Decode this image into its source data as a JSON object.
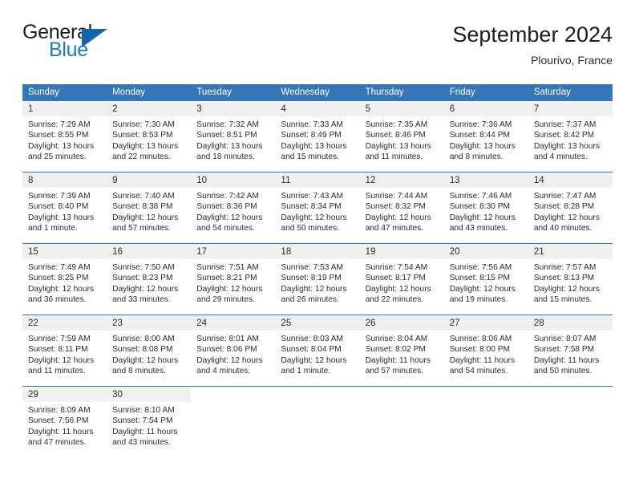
{
  "brand": {
    "line1": "General",
    "line2": "Blue",
    "triangle_color": "#1565a8",
    "blue_text_color": "#1f7ac4"
  },
  "header": {
    "title": "September 2024",
    "subtitle": "Plourivo, France"
  },
  "theme": {
    "header_bg": "#3576b8",
    "daynum_bg": "#f0f0f0",
    "text": "#2b2b2b",
    "row_divider": "#3576b8"
  },
  "weekdays": [
    "Sunday",
    "Monday",
    "Tuesday",
    "Wednesday",
    "Thursday",
    "Friday",
    "Saturday"
  ],
  "weeks": [
    [
      {
        "day": "1",
        "sunrise": "Sunrise: 7:29 AM",
        "sunset": "Sunset: 8:55 PM",
        "daylight": "Daylight: 13 hours and 25 minutes."
      },
      {
        "day": "2",
        "sunrise": "Sunrise: 7:30 AM",
        "sunset": "Sunset: 8:53 PM",
        "daylight": "Daylight: 13 hours and 22 minutes."
      },
      {
        "day": "3",
        "sunrise": "Sunrise: 7:32 AM",
        "sunset": "Sunset: 8:51 PM",
        "daylight": "Daylight: 13 hours and 18 minutes."
      },
      {
        "day": "4",
        "sunrise": "Sunrise: 7:33 AM",
        "sunset": "Sunset: 8:49 PM",
        "daylight": "Daylight: 13 hours and 15 minutes."
      },
      {
        "day": "5",
        "sunrise": "Sunrise: 7:35 AM",
        "sunset": "Sunset: 8:46 PM",
        "daylight": "Daylight: 13 hours and 11 minutes."
      },
      {
        "day": "6",
        "sunrise": "Sunrise: 7:36 AM",
        "sunset": "Sunset: 8:44 PM",
        "daylight": "Daylight: 13 hours and 8 minutes."
      },
      {
        "day": "7",
        "sunrise": "Sunrise: 7:37 AM",
        "sunset": "Sunset: 8:42 PM",
        "daylight": "Daylight: 13 hours and 4 minutes."
      }
    ],
    [
      {
        "day": "8",
        "sunrise": "Sunrise: 7:39 AM",
        "sunset": "Sunset: 8:40 PM",
        "daylight": "Daylight: 13 hours and 1 minute."
      },
      {
        "day": "9",
        "sunrise": "Sunrise: 7:40 AM",
        "sunset": "Sunset: 8:38 PM",
        "daylight": "Daylight: 12 hours and 57 minutes."
      },
      {
        "day": "10",
        "sunrise": "Sunrise: 7:42 AM",
        "sunset": "Sunset: 8:36 PM",
        "daylight": "Daylight: 12 hours and 54 minutes."
      },
      {
        "day": "11",
        "sunrise": "Sunrise: 7:43 AM",
        "sunset": "Sunset: 8:34 PM",
        "daylight": "Daylight: 12 hours and 50 minutes."
      },
      {
        "day": "12",
        "sunrise": "Sunrise: 7:44 AM",
        "sunset": "Sunset: 8:32 PM",
        "daylight": "Daylight: 12 hours and 47 minutes."
      },
      {
        "day": "13",
        "sunrise": "Sunrise: 7:46 AM",
        "sunset": "Sunset: 8:30 PM",
        "daylight": "Daylight: 12 hours and 43 minutes."
      },
      {
        "day": "14",
        "sunrise": "Sunrise: 7:47 AM",
        "sunset": "Sunset: 8:28 PM",
        "daylight": "Daylight: 12 hours and 40 minutes."
      }
    ],
    [
      {
        "day": "15",
        "sunrise": "Sunrise: 7:49 AM",
        "sunset": "Sunset: 8:25 PM",
        "daylight": "Daylight: 12 hours and 36 minutes."
      },
      {
        "day": "16",
        "sunrise": "Sunrise: 7:50 AM",
        "sunset": "Sunset: 8:23 PM",
        "daylight": "Daylight: 12 hours and 33 minutes."
      },
      {
        "day": "17",
        "sunrise": "Sunrise: 7:51 AM",
        "sunset": "Sunset: 8:21 PM",
        "daylight": "Daylight: 12 hours and 29 minutes."
      },
      {
        "day": "18",
        "sunrise": "Sunrise: 7:53 AM",
        "sunset": "Sunset: 8:19 PM",
        "daylight": "Daylight: 12 hours and 26 minutes."
      },
      {
        "day": "19",
        "sunrise": "Sunrise: 7:54 AM",
        "sunset": "Sunset: 8:17 PM",
        "daylight": "Daylight: 12 hours and 22 minutes."
      },
      {
        "day": "20",
        "sunrise": "Sunrise: 7:56 AM",
        "sunset": "Sunset: 8:15 PM",
        "daylight": "Daylight: 12 hours and 19 minutes."
      },
      {
        "day": "21",
        "sunrise": "Sunrise: 7:57 AM",
        "sunset": "Sunset: 8:13 PM",
        "daylight": "Daylight: 12 hours and 15 minutes."
      }
    ],
    [
      {
        "day": "22",
        "sunrise": "Sunrise: 7:59 AM",
        "sunset": "Sunset: 8:11 PM",
        "daylight": "Daylight: 12 hours and 11 minutes."
      },
      {
        "day": "23",
        "sunrise": "Sunrise: 8:00 AM",
        "sunset": "Sunset: 8:08 PM",
        "daylight": "Daylight: 12 hours and 8 minutes."
      },
      {
        "day": "24",
        "sunrise": "Sunrise: 8:01 AM",
        "sunset": "Sunset: 8:06 PM",
        "daylight": "Daylight: 12 hours and 4 minutes."
      },
      {
        "day": "25",
        "sunrise": "Sunrise: 8:03 AM",
        "sunset": "Sunset: 8:04 PM",
        "daylight": "Daylight: 12 hours and 1 minute."
      },
      {
        "day": "26",
        "sunrise": "Sunrise: 8:04 AM",
        "sunset": "Sunset: 8:02 PM",
        "daylight": "Daylight: 11 hours and 57 minutes."
      },
      {
        "day": "27",
        "sunrise": "Sunrise: 8:06 AM",
        "sunset": "Sunset: 8:00 PM",
        "daylight": "Daylight: 11 hours and 54 minutes."
      },
      {
        "day": "28",
        "sunrise": "Sunrise: 8:07 AM",
        "sunset": "Sunset: 7:58 PM",
        "daylight": "Daylight: 11 hours and 50 minutes."
      }
    ],
    [
      {
        "day": "29",
        "sunrise": "Sunrise: 8:09 AM",
        "sunset": "Sunset: 7:56 PM",
        "daylight": "Daylight: 11 hours and 47 minutes."
      },
      {
        "day": "30",
        "sunrise": "Sunrise: 8:10 AM",
        "sunset": "Sunset: 7:54 PM",
        "daylight": "Daylight: 11 hours and 43 minutes."
      },
      {
        "day": "",
        "sunrise": "",
        "sunset": "",
        "daylight": ""
      },
      {
        "day": "",
        "sunrise": "",
        "sunset": "",
        "daylight": ""
      },
      {
        "day": "",
        "sunrise": "",
        "sunset": "",
        "daylight": ""
      },
      {
        "day": "",
        "sunrise": "",
        "sunset": "",
        "daylight": ""
      },
      {
        "day": "",
        "sunrise": "",
        "sunset": "",
        "daylight": ""
      }
    ]
  ]
}
